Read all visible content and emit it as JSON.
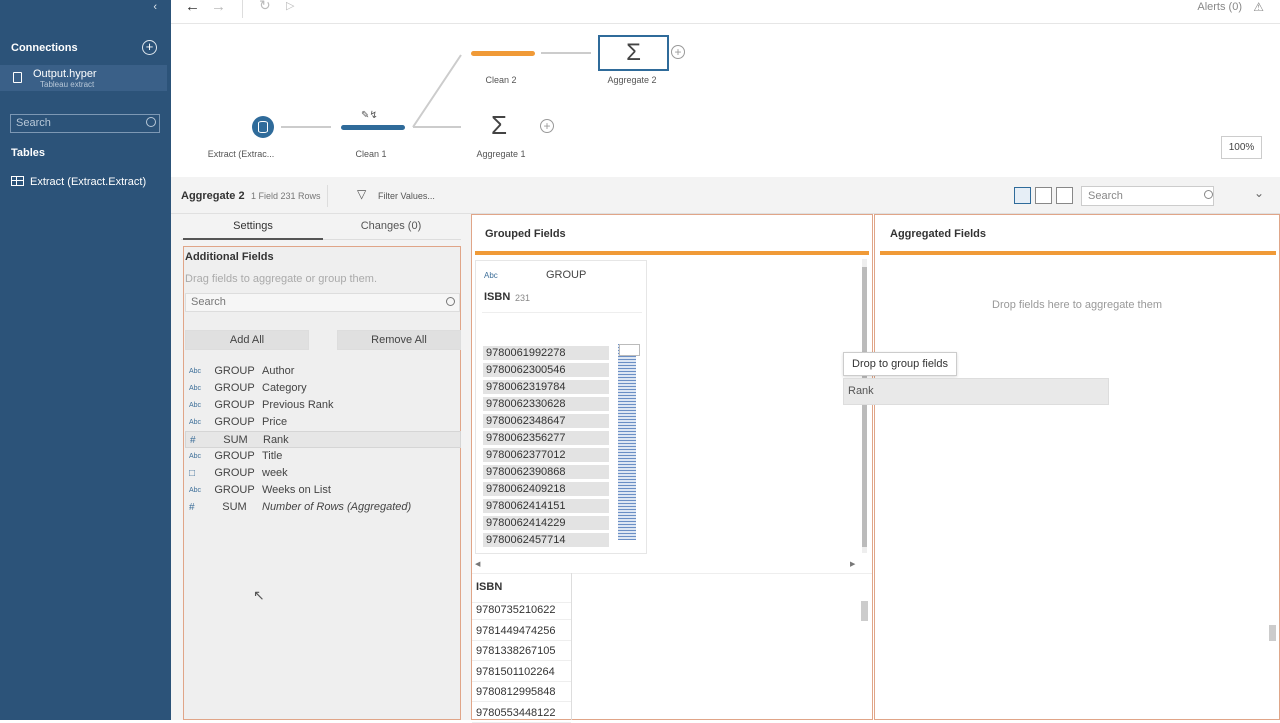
{
  "sidebar": {
    "connections_heading": "Connections",
    "connection": {
      "name": "Output.hyper",
      "type": "Tableau extract"
    },
    "search_placeholder": "Search",
    "tables_heading": "Tables",
    "table_item": "Extract (Extract.Extract)"
  },
  "topbar": {
    "alerts": "Alerts (0)"
  },
  "flow": {
    "nodes": [
      {
        "label": "Extract (Extrac..."
      },
      {
        "label": "Clean 1"
      },
      {
        "label": "Clean 2"
      },
      {
        "label": "Aggregate 1"
      },
      {
        "label": "Aggregate 2"
      }
    ],
    "zoom": "100%"
  },
  "panel": {
    "title": "Aggregate 2",
    "meta": "1 Field   231 Rows",
    "filter": "Filter Values...",
    "search_placeholder": "Search"
  },
  "settings": {
    "tabs": [
      "Settings",
      "Changes (0)"
    ],
    "additional_fields": "Additional Fields",
    "hint": "Drag fields to aggregate or group them.",
    "search_placeholder": "Search",
    "add_all": "Add All",
    "remove_all": "Remove All",
    "fields": [
      {
        "type": "Abc",
        "agg": "GROUP",
        "name": "Author"
      },
      {
        "type": "Abc",
        "agg": "GROUP",
        "name": "Category"
      },
      {
        "type": "Abc",
        "agg": "GROUP",
        "name": "Previous Rank"
      },
      {
        "type": "Abc",
        "agg": "GROUP",
        "name": "Price"
      },
      {
        "type": "#",
        "agg": "SUM",
        "name": "Rank"
      },
      {
        "type": "Abc",
        "agg": "GROUP",
        "name": "Title"
      },
      {
        "type": "date",
        "agg": "GROUP",
        "name": "week"
      },
      {
        "type": "Abc",
        "agg": "GROUP",
        "name": "Weeks on List"
      },
      {
        "type": "#",
        "agg": "SUM",
        "name": "Number of Rows (Aggregated)"
      }
    ]
  },
  "grouped": {
    "title": "Grouped Fields",
    "card": {
      "type": "Abc",
      "agg": "GROUP",
      "name": "ISBN",
      "count": "231"
    },
    "values": [
      "9780061992278",
      "9780062300546",
      "9780062319784",
      "9780062330628",
      "9780062348647",
      "9780062356277",
      "9780062377012",
      "9780062390868",
      "9780062409218",
      "9780062414151",
      "9780062414229",
      "9780062457714"
    ],
    "tooltip": "Drop to group fields",
    "dragged_field": "Rank"
  },
  "aggregated": {
    "title": "Aggregated Fields",
    "hint": "Drop fields here to aggregate them"
  },
  "data_grid": {
    "column": "ISBN",
    "rows": [
      "9780735210622",
      "9781449474256",
      "9781338267105",
      "9781501102264",
      "9780812995848",
      "9780553448122"
    ]
  }
}
